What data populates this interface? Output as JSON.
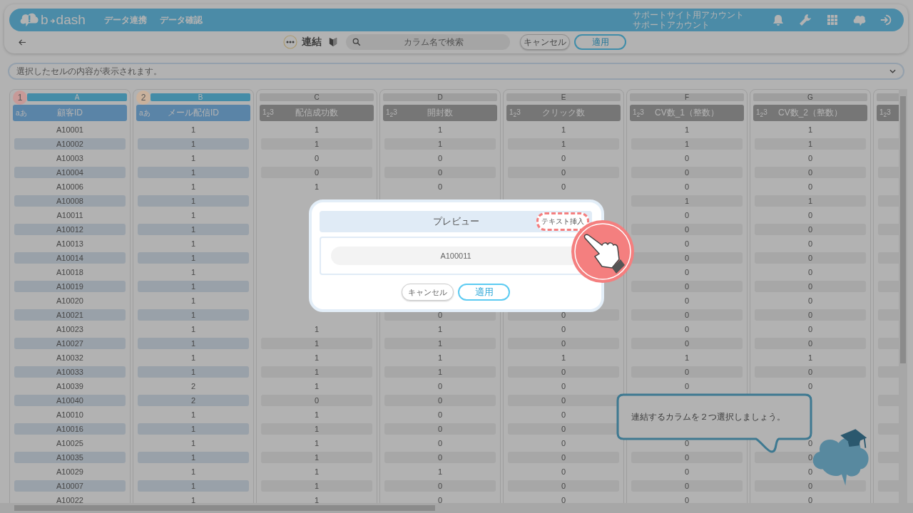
{
  "header": {
    "logo_left": "b",
    "logo_right": "dash",
    "nav": [
      "データ連携",
      "データ確認"
    ],
    "account": [
      "サポートサイト用アカウント",
      "サポートアカウント"
    ]
  },
  "toolbar": {
    "title": "連結",
    "search": {
      "placeholder": "カラム名で検索"
    },
    "buttons": [
      {
        "label": "キャンセル",
        "kind": "secondary"
      },
      {
        "label": "適用",
        "kind": "primary"
      }
    ]
  },
  "cell_preview": {
    "placeholder": "選択したセルの内容が表示されます。"
  },
  "columns": [
    {
      "letter": "A",
      "type_icon": "aあ",
      "name": "顧客ID",
      "selected": true,
      "badge": {
        "label": "1",
        "color": "#c79a98"
      }
    },
    {
      "letter": "B",
      "type_icon": "aあ",
      "name": "メール配信ID",
      "selected": true,
      "badge": {
        "label": "2",
        "color": "#c9b19c"
      }
    },
    {
      "letter": "C",
      "type_icon": "1$_{2}$3",
      "name": "配信成功数",
      "selected": false
    },
    {
      "letter": "D",
      "type_icon": "1$_{2}$3",
      "name": "開封数",
      "selected": false
    },
    {
      "letter": "E",
      "type_icon": "1$_{2}$3",
      "name": "クリック数",
      "selected": false
    },
    {
      "letter": "F",
      "type_icon": "1$_{2}$3",
      "name": "CV数_1（整数）",
      "selected": false
    },
    {
      "letter": "G",
      "type_icon": "1$_{2}$3",
      "name": "CV数_2（整数）",
      "selected": false
    },
    {
      "type_icon": "1$_{2}$3",
      "selected": false
    }
  ],
  "rows": [
    [
      "A10001",
      "1",
      "1",
      "1",
      "1",
      "1",
      "1"
    ],
    [
      "A10002",
      "1",
      "1",
      "1",
      "1",
      "1",
      "1"
    ],
    [
      "A10003",
      "1",
      "0",
      "0",
      "0",
      "0",
      "0"
    ],
    [
      "A10004",
      "1",
      "0",
      "0",
      "0",
      "0",
      "0"
    ],
    [
      "A10006",
      "1",
      "1",
      "0",
      "0",
      "0",
      "0"
    ],
    [
      "A10008",
      "1",
      null,
      null,
      null,
      "1",
      "1"
    ],
    [
      "A10011",
      "1",
      null,
      null,
      null,
      "0",
      "0"
    ],
    [
      "A10012",
      "1",
      null,
      null,
      null,
      "0",
      "0"
    ],
    [
      "A10013",
      "1",
      null,
      null,
      null,
      "0",
      "0"
    ],
    [
      "A10014",
      "1",
      null,
      null,
      null,
      "0",
      "0"
    ],
    [
      "A10018",
      "1",
      null,
      null,
      null,
      "0",
      "0"
    ],
    [
      "A10019",
      "1",
      null,
      null,
      null,
      "0",
      "0"
    ],
    [
      "A10020",
      "1",
      null,
      null,
      null,
      "0",
      "0"
    ],
    [
      "A10021",
      "1",
      null,
      "0",
      "0",
      "0",
      "0"
    ],
    [
      "A10023",
      "1",
      "1",
      "1",
      "0",
      "0",
      "0"
    ],
    [
      "A10027",
      "1",
      "1",
      "1",
      "0",
      "0",
      "0"
    ],
    [
      "A10032",
      "1",
      "1",
      "1",
      "1",
      "1",
      "1"
    ],
    [
      "A10033",
      "1",
      "1",
      "1",
      "0",
      "0",
      "0"
    ],
    [
      "A10039",
      "2",
      "1",
      "0",
      "0",
      "0",
      "0"
    ],
    [
      "A10040",
      "2",
      "0",
      "0",
      "0",
      null,
      null
    ],
    [
      "A10010",
      "1",
      "1",
      "0",
      "0",
      null,
      null
    ],
    [
      "A10016",
      "1",
      "1",
      "0",
      "0",
      null,
      null
    ],
    [
      "A10025",
      "1",
      "1",
      "0",
      "0",
      "0",
      "0"
    ],
    [
      "A10035",
      "1",
      "1",
      "0",
      "0",
      "0",
      "0"
    ],
    [
      "A10029",
      "1",
      "1",
      "1",
      "0",
      "0",
      "0"
    ],
    [
      "A10007",
      "1",
      "1",
      "0",
      "0",
      "0",
      "0"
    ],
    [
      "A10022",
      "1",
      "1",
      "0",
      "0",
      "0",
      "0"
    ]
  ],
  "dialog": {
    "title": "プレビュー",
    "insert_button": "テキスト挿入",
    "value": "A100011",
    "buttons": [
      {
        "label": "キャンセル",
        "kind": "secondary"
      },
      {
        "label": "適用",
        "kind": "primary"
      }
    ]
  },
  "tooltip": {
    "text": "連結するカラムを２つ選択しましょう。"
  }
}
